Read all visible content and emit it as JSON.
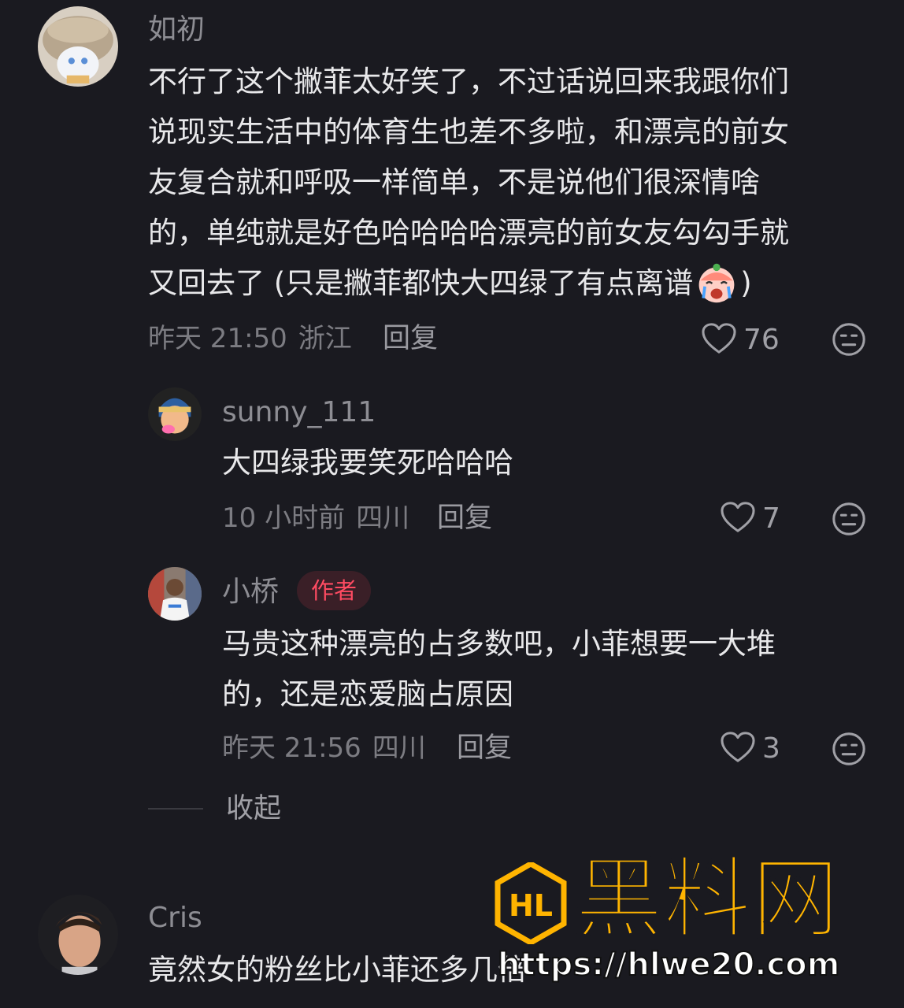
{
  "comments": [
    {
      "username": "如初",
      "lines": [
        "不行了这个撇菲太好笑了，不过话说回来我跟你们",
        "说现实生活中的体育生也差不多啦，和漂亮的前女",
        "友复合就和呼吸一样简单，不是说他们很深情啥",
        "的，单纯就是好色哈哈哈哈漂亮的前女友勾勾手就",
        "又回去了 (只是撇菲都快大四绿了有点离谱",
        ")"
      ],
      "emoji": "crying-laughing-emoji",
      "time": "昨天 21:50",
      "location": "浙江",
      "reply_label": "回复",
      "likes": "76",
      "replies": [
        {
          "username": "sunny_111",
          "text": "大四绿我要笑死哈哈哈",
          "time": "10 小时前",
          "location": "四川",
          "reply_label": "回复",
          "likes": "7"
        },
        {
          "username": "小桥",
          "badge": "作者",
          "lines": [
            "马贵这种漂亮的占多数吧，小菲想要一大堆",
            "的，还是恋爱脑占原因"
          ],
          "time": "昨天 21:56",
          "location": "四川",
          "reply_label": "回复",
          "likes": "3"
        }
      ],
      "collapse_label": "收起"
    },
    {
      "username": "Cris",
      "text": "竟然女的粉丝比小菲还多几倍"
    }
  ],
  "watermark": {
    "logo": "HL",
    "title": "黑料网",
    "url": "https://hlwe20.com"
  },
  "icons": {
    "like": "heart-outline-icon",
    "dislike": "meh-face-icon"
  },
  "colors": {
    "background": "#1a1a20",
    "author_badge": "#ff4b62",
    "watermark": "#ffb400"
  }
}
